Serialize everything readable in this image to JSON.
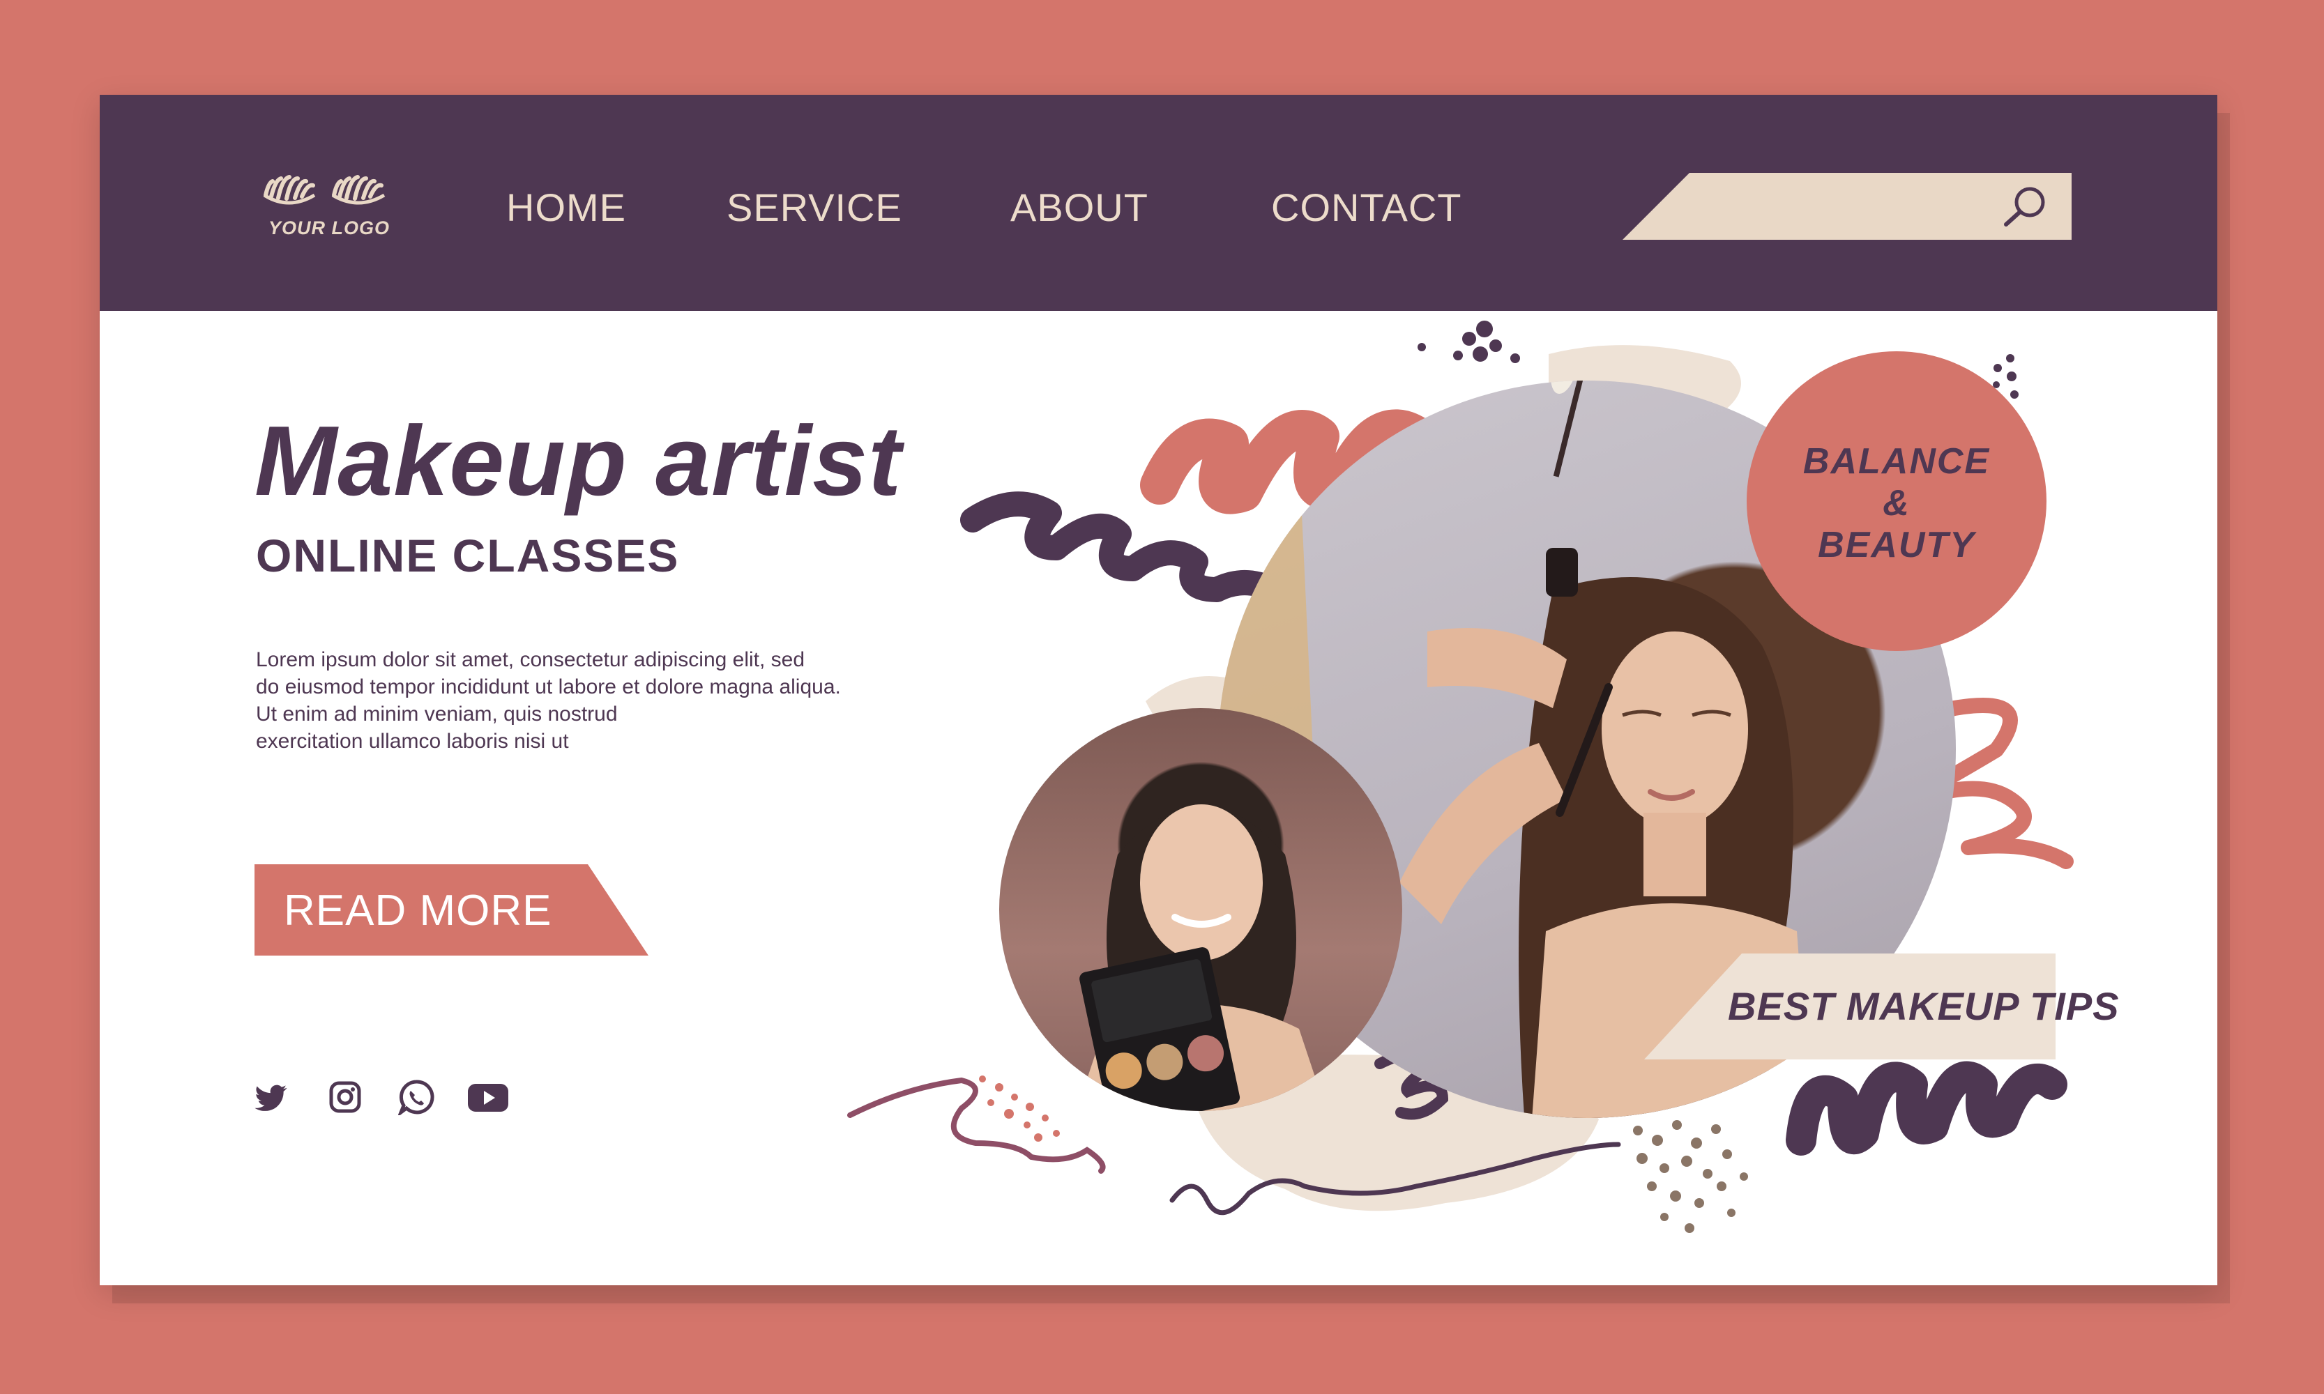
{
  "colors": {
    "background": "#d4756b",
    "header": "#4e3752",
    "accent": "#d4756b",
    "cream": "#e9d8c6",
    "text": "#4e3752"
  },
  "header": {
    "logo_text": "YOUR LOGO",
    "nav": [
      "HOME",
      "SERVICE",
      "ABOUT",
      "CONTACT"
    ],
    "search": {
      "placeholder": "",
      "icon": "search-icon"
    }
  },
  "hero": {
    "title": "Makeup artist",
    "subtitle": "ONLINE CLASSES",
    "body_lines": [
      "Lorem ipsum dolor sit amet, consectetur adipiscing elit, sed",
      "do eiusmod tempor incididunt ut labore et dolore magna aliqua.",
      "Ut enim ad minim veniam, quis nostrud",
      "exercitation ullamco laboris nisi ut"
    ],
    "cta_label": "READ MORE"
  },
  "social": [
    "twitter-icon",
    "instagram-icon",
    "whatsapp-icon",
    "youtube-icon"
  ],
  "badge": {
    "line1": "BALANCE",
    "line2": "&",
    "line3": "BEAUTY"
  },
  "tips_banner": "BEST MAKEUP TIPS"
}
